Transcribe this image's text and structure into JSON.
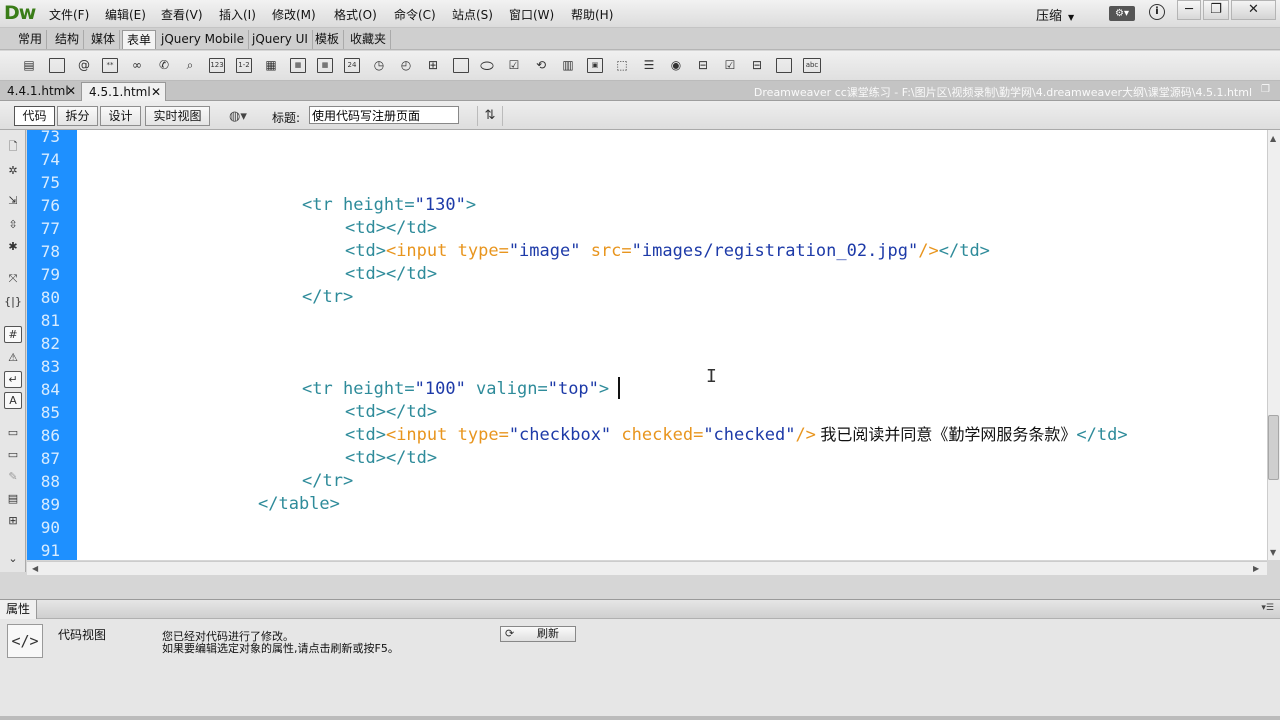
{
  "app": {
    "logo": "Dw",
    "workspace": "压缩"
  },
  "menu": [
    "文件(F)",
    "编辑(E)",
    "查看(V)",
    "插入(I)",
    "修改(M)",
    "格式(O)",
    "命令(C)",
    "站点(S)",
    "窗口(W)",
    "帮助(H)"
  ],
  "window_buttons": {
    "minimize": "─",
    "restore": "❐",
    "close": "✕"
  },
  "insert_tabs": [
    "常用",
    "结构",
    "媒体",
    "表单",
    "jQuery Mobile",
    "jQuery UI",
    "模板",
    "收藏夹"
  ],
  "active_insert_tab": "表单",
  "doc_tabs": [
    {
      "name": "4.4.1.html"
    },
    {
      "name": "4.5.1.html"
    }
  ],
  "doc_path": "Dreamweaver cc课堂练习 - F:\\图片区\\视频录制\\勤学网\\4.dreamweaver大纲\\课堂源码\\4.5.1.html",
  "view_buttons": [
    "代码",
    "拆分",
    "设计",
    "实时视图"
  ],
  "title_label": "标题:",
  "title_value": "使用代码写注册页面",
  "line_numbers": [
    "73",
    "74",
    "75",
    "76",
    "77",
    "78",
    "79",
    "80",
    "81",
    "82",
    "83",
    "84",
    "85",
    "86",
    "87",
    "88",
    "89",
    "90",
    "91"
  ],
  "code": {
    "l76": {
      "open": "<tr ",
      "a1": "height",
      "eq": "=",
      "v1": "\"130\"",
      "close": ">"
    },
    "l77": "<td></td>",
    "l78": {
      "open": "<td>",
      "inp": "<input ",
      "a1": "type",
      "eq1": "=",
      "v1": "\"image\"",
      "a2": " src",
      "eq2": "=",
      "v2": "\"images/registration_02.jpg\"",
      "end": "/>",
      "close": "</td>"
    },
    "l79": "<td></td>",
    "l80": "</tr>",
    "l84": {
      "open": "<tr ",
      "a1": "height",
      "eq1": "=",
      "v1": "\"100\"",
      "a2": " valign",
      "eq2": "=",
      "v2": "\"top\"",
      "close": ">"
    },
    "l85": "<td></td>",
    "l86": {
      "open": "<td>",
      "inp": "<input ",
      "a1": "type",
      "eq1": "=",
      "v1": "\"checkbox\"",
      "a2": " checked",
      "eq2": "=",
      "v2": "\"checked\"",
      "end": "/>",
      "text": " 我已阅读并同意《勤学网服务条款》",
      "close": "</td>"
    },
    "l87": "<td></td>",
    "l88": "</tr>",
    "l89": "</table>"
  },
  "properties": {
    "title": "属性",
    "label": "代码视图",
    "message1": "您已经对代码进行了修改。",
    "message2": "如果要编辑选定对象的属性,请点击刷新或按F5。",
    "refresh": "刷新"
  },
  "colors": {
    "gutter": "#1e90ff",
    "tag": "#2e8b9a",
    "attr_orange": "#e8951e",
    "value": "#1d3aa8"
  }
}
